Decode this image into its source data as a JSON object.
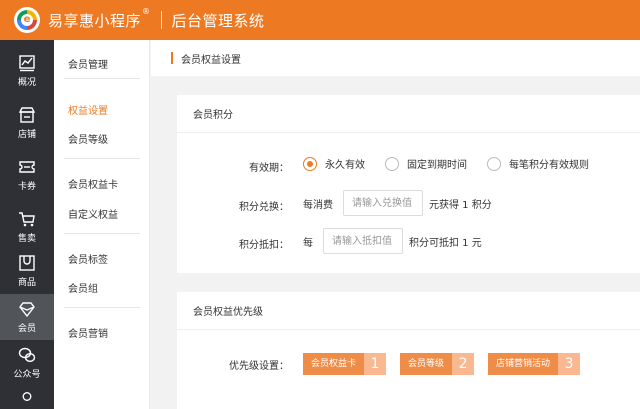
{
  "header": {
    "brand": "易享惠小程序",
    "brand_mark": "®",
    "title": "后台管理系统"
  },
  "sidebar": {
    "items": [
      {
        "label": "概况",
        "icon": "chart-icon"
      },
      {
        "label": "店铺",
        "icon": "store-icon"
      },
      {
        "label": "卡券",
        "icon": "ticket-icon"
      },
      {
        "label": "售卖",
        "icon": "cart-icon"
      },
      {
        "label": "商品",
        "icon": "goods-icon"
      },
      {
        "label": "会员",
        "icon": "diamond-icon",
        "active": true
      },
      {
        "label": "公众号",
        "icon": "wechat-icon"
      }
    ]
  },
  "subnav": {
    "items": [
      "会员管理",
      "权益设置",
      "会员等级",
      "会员权益卡",
      "自定义权益",
      "会员标签",
      "会员组",
      "会员营销"
    ],
    "active": "权益设置"
  },
  "breadcrumb": "会员权益设置",
  "points_card": {
    "title": "会员积分",
    "validity_label": "有效期：",
    "validity_options": [
      "永久有效",
      "固定到期时间",
      "每笔积分有效规则"
    ],
    "validity_selected": "永久有效",
    "exchange_label": "积分兑换：",
    "exchange_prefix": "每消费",
    "exchange_placeholder": "请输入兑换值",
    "exchange_suffix": "元获得 1 积分",
    "deduct_label": "积分抵扣：",
    "deduct_prefix": "每",
    "deduct_placeholder": "请输入抵扣值",
    "deduct_suffix": "积分可抵扣 1 元"
  },
  "priority_card": {
    "title": "会员权益优先级",
    "label": "优先级设置：",
    "items": [
      {
        "label": "会员权益卡",
        "num": "1"
      },
      {
        "label": "会员等级",
        "num": "2"
      },
      {
        "label": "店铺营销活动",
        "num": "3"
      }
    ]
  },
  "colors": {
    "accent": "#ed7a23",
    "sidebar_bg": "#2e3036",
    "priority_label_bg": "#ef8d48",
    "priority_num_bg": "#f9b88f"
  }
}
